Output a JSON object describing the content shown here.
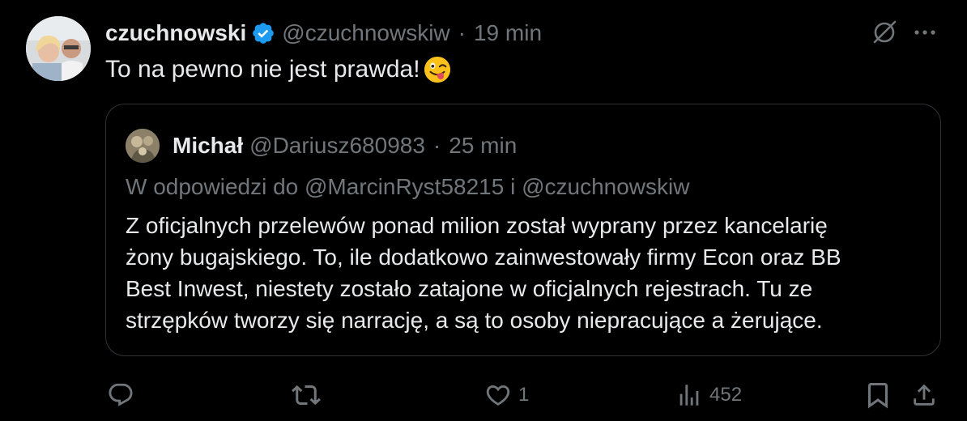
{
  "author": {
    "display_name": "czuchnowski",
    "handle": "@czuchnowskiw",
    "separator": "·",
    "time": "19 min",
    "verified": true,
    "avatar": "avatar-photo"
  },
  "tweet": {
    "text": "To na pewno nie jest prawda!",
    "emoji": "winking-face-with-tongue"
  },
  "quote": {
    "display_name": "Michał",
    "handle": "@Dariusz680983",
    "separator": "·",
    "time": "25 min",
    "reply_context": "W odpowiedzi do @MarcinRyst58215 i @czuchnowskiw",
    "body_lines": [
      "Z oficjalnych przelewów ponad milion został wyprany przez kancelarię",
      "żony bugajskiego. To, ile dodatkowo zainwestowały firmy Econ oraz BB",
      "Best Inwest, niestety zostało zatajone w oficjalnych rejestrach. Tu ze",
      "strzępków tworzy się narrację, a są to osoby niepracujące a żerujące."
    ]
  },
  "actions": {
    "reply": {
      "icon": "reply-icon",
      "count": ""
    },
    "retweet": {
      "icon": "retweet-icon",
      "count": ""
    },
    "like": {
      "icon": "heart-icon",
      "count": "1"
    },
    "views": {
      "icon": "views-icon",
      "count": "452"
    },
    "bookmark": {
      "icon": "bookmark-icon"
    },
    "share": {
      "icon": "share-icon"
    }
  },
  "colors": {
    "background": "#000000",
    "text_primary": "#e7e9ea",
    "text_secondary": "#71767b",
    "border": "#2f3336",
    "verified_blue": "#1d9bf0"
  }
}
